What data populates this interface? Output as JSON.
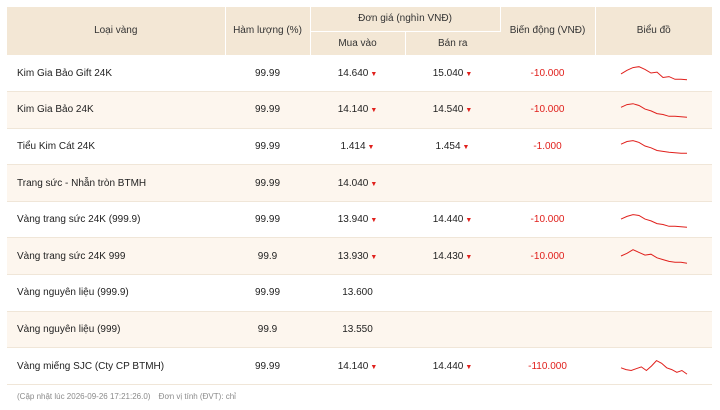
{
  "header": {
    "col_type": "Loại vàng",
    "col_purity": "Hàm lượng (%)",
    "col_price_group": "Đơn giá (nghìn VNĐ)",
    "col_buy": "Mua vào",
    "col_sell": "Bán ra",
    "col_change": "Biến động (VNĐ)",
    "col_chart": "Biểu đồ"
  },
  "trend_color": "#e0201c",
  "rows": [
    {
      "name": "Kim Gia Bảo Gift 24K",
      "purity": "99.99",
      "buy": "14.640",
      "buy_down": true,
      "sell": "15.040",
      "sell_down": true,
      "change": "-10.000",
      "spark": [
        0.55,
        0.35,
        0.2,
        0.15,
        0.3,
        0.5,
        0.45,
        0.75,
        0.7,
        0.85,
        0.85,
        0.88
      ]
    },
    {
      "name": "Kim Gia Bảo 24K",
      "purity": "99.99",
      "buy": "14.140",
      "buy_down": true,
      "sell": "14.540",
      "sell_down": true,
      "change": "-10.000",
      "spark": [
        0.35,
        0.2,
        0.15,
        0.25,
        0.45,
        0.55,
        0.7,
        0.75,
        0.85,
        0.85,
        0.88,
        0.9
      ]
    },
    {
      "name": "Tiểu Kim Cát 24K",
      "purity": "99.99",
      "buy": "1.414",
      "buy_down": true,
      "sell": "1.454",
      "sell_down": true,
      "change": "-1.000",
      "spark": [
        0.4,
        0.25,
        0.2,
        0.3,
        0.5,
        0.6,
        0.75,
        0.8,
        0.85,
        0.88,
        0.9,
        0.9
      ]
    },
    {
      "name": "Trang sức - Nhẫn tròn BTMH",
      "purity": "99.99",
      "buy": "14.040",
      "buy_down": true,
      "sell": "",
      "sell_down": false,
      "change": "",
      "spark": []
    },
    {
      "name": "Vàng trang sức 24K (999.9)",
      "purity": "99.99",
      "buy": "13.940",
      "buy_down": true,
      "sell": "14.440",
      "sell_down": true,
      "change": "-10.000",
      "spark": [
        0.45,
        0.3,
        0.2,
        0.25,
        0.45,
        0.55,
        0.7,
        0.75,
        0.85,
        0.85,
        0.88,
        0.9
      ]
    },
    {
      "name": "Vàng trang sức 24K 999",
      "purity": "99.9",
      "buy": "13.930",
      "buy_down": true,
      "sell": "14.430",
      "sell_down": true,
      "change": "-10.000",
      "spark": [
        0.5,
        0.35,
        0.15,
        0.3,
        0.45,
        0.4,
        0.6,
        0.7,
        0.8,
        0.85,
        0.85,
        0.9
      ]
    },
    {
      "name": "Vàng nguyên liệu (999.9)",
      "purity": "99.99",
      "buy": "13.600",
      "buy_down": false,
      "sell": "",
      "sell_down": false,
      "change": "",
      "spark": []
    },
    {
      "name": "Vàng nguyên liệu (999)",
      "purity": "99.9",
      "buy": "13.550",
      "buy_down": false,
      "sell": "",
      "sell_down": false,
      "change": "",
      "spark": []
    },
    {
      "name": "Vàng miếng SJC (Cty CP BTMH)",
      "purity": "99.99",
      "buy": "14.140",
      "buy_down": true,
      "sell": "14.440",
      "sell_down": true,
      "change": "-110.000",
      "spark": [
        0.6,
        0.7,
        0.75,
        0.65,
        0.55,
        0.75,
        0.5,
        0.2,
        0.35,
        0.6,
        0.7,
        0.85,
        0.75,
        0.95
      ]
    }
  ],
  "footer": {
    "updated": "(Cập nhật lúc 2026-09-26 17:21:26.0)",
    "unit": "Đơn vị tính (ĐVT): chỉ"
  }
}
